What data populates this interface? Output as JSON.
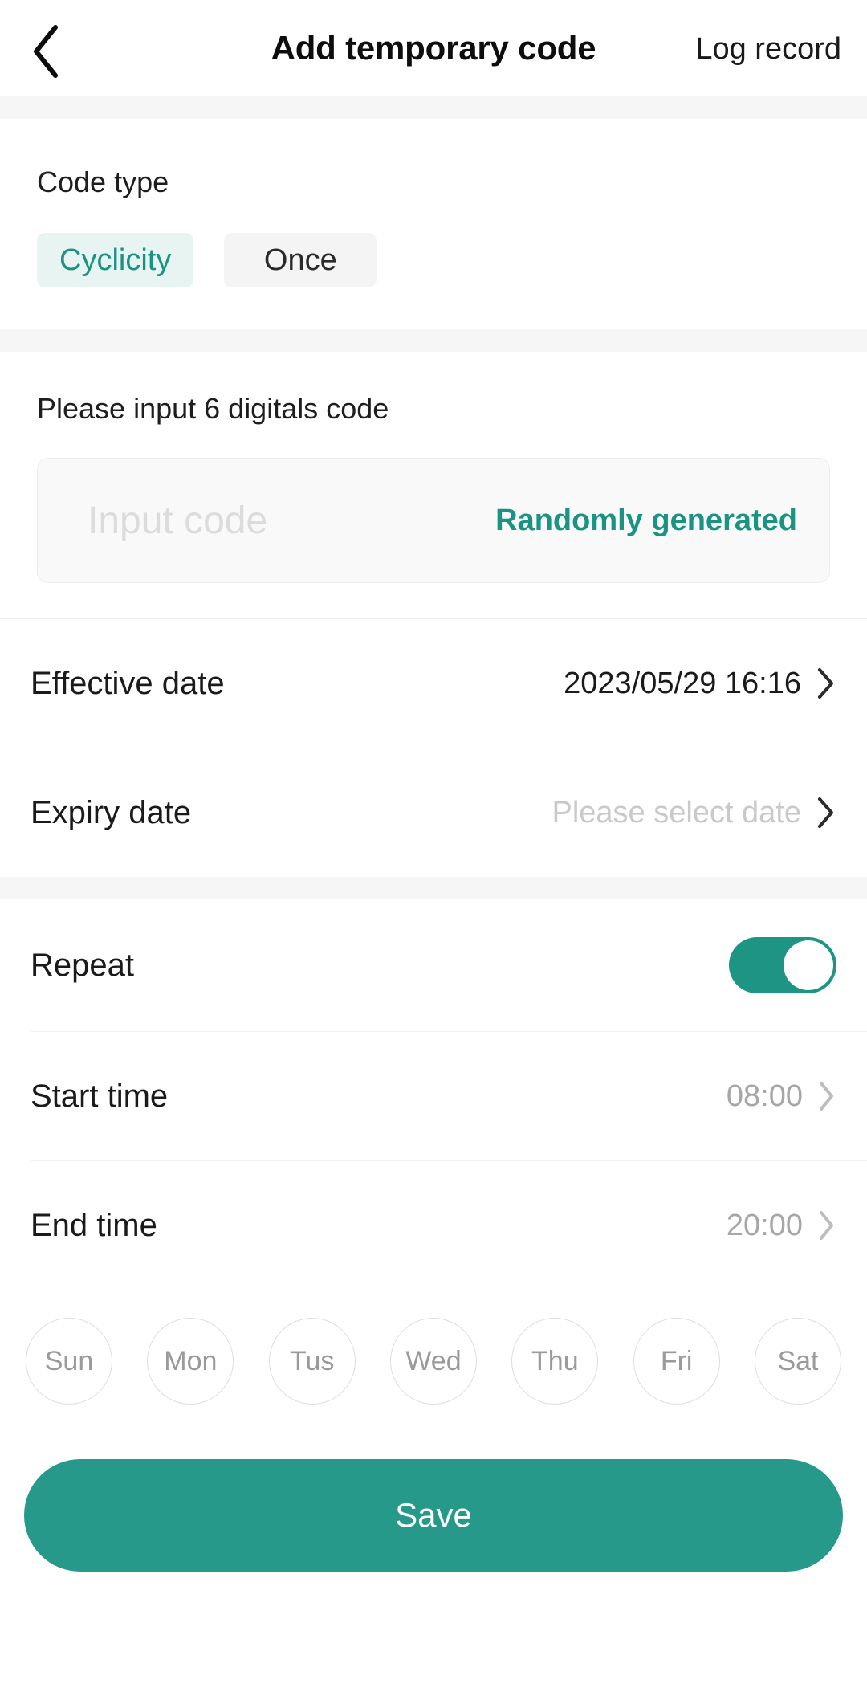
{
  "header": {
    "back_icon": "chevron-left-icon",
    "title": "Add temporary code",
    "action_label": "Log record"
  },
  "code_type": {
    "label": "Code type",
    "options": [
      {
        "label": "Cyclicity",
        "selected": true
      },
      {
        "label": "Once",
        "selected": false
      }
    ]
  },
  "code_input": {
    "hint": "Please input 6 digitals code",
    "placeholder": "Input code",
    "value": "",
    "random_button": "Randomly generated"
  },
  "dates": [
    {
      "label": "Effective date",
      "value": "2023/05/29 16:16",
      "muted": false
    },
    {
      "label": "Expiry date",
      "value": "Please select date",
      "muted": true
    }
  ],
  "repeat": {
    "label": "Repeat",
    "enabled": true
  },
  "times": [
    {
      "label": "Start time",
      "value": "08:00"
    },
    {
      "label": "End time",
      "value": "20:00"
    }
  ],
  "days": [
    {
      "label": "Sun",
      "selected": false
    },
    {
      "label": "Mon",
      "selected": false
    },
    {
      "label": "Tus",
      "selected": false
    },
    {
      "label": "Wed",
      "selected": false
    },
    {
      "label": "Thu",
      "selected": false
    },
    {
      "label": "Fri",
      "selected": false
    },
    {
      "label": "Sat",
      "selected": false
    }
  ],
  "save": {
    "label": "Save"
  },
  "colors": {
    "accent": "#1a9383",
    "accent_button": "#26998b",
    "chip_active_bg": "#e7f4f1",
    "chip_inactive_bg": "#f4f4f5",
    "section_gap": "#f6f6f7",
    "muted_text": "#c9c9c9"
  }
}
